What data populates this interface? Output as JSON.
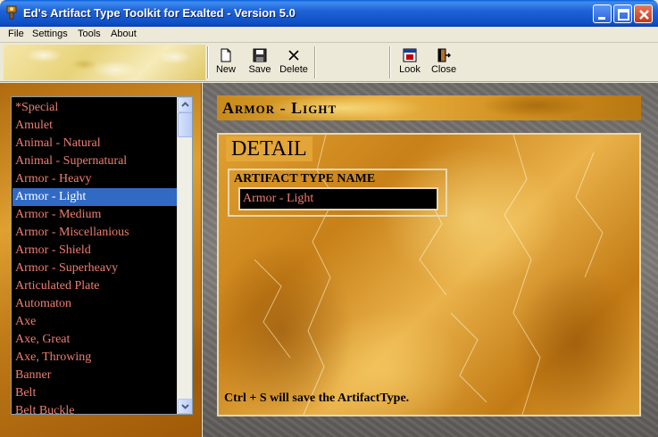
{
  "window": {
    "title": "Ed's Artifact Type Toolkit for Exalted - Version 5.0",
    "controls": [
      "minimize-icon",
      "maximize-icon",
      "close-icon"
    ]
  },
  "menu": {
    "items": [
      "File",
      "Settings",
      "Tools",
      "About"
    ]
  },
  "toolbar": {
    "new_label": "New",
    "save_label": "Save",
    "delete_label": "Delete",
    "look_label": "Look",
    "close_label": "Close"
  },
  "artifact_list": {
    "items": [
      "*Special",
      "Amulet",
      "Animal - Natural",
      "Animal - Supernatural",
      "Armor - Heavy",
      "Armor - Light",
      "Armor - Medium",
      "Armor - Miscellanious",
      "Armor - Shield",
      "Armor - Superheavy",
      "Articulated Plate",
      "Automaton",
      "Axe",
      "Axe, Great",
      "Axe, Throwing",
      "Banner",
      "Belt",
      "Belt Buckle"
    ],
    "selected": "Armor - Light"
  },
  "header": {
    "title": "Armor - Light"
  },
  "detail": {
    "section_label": "DETAIL",
    "name_label": "ARTIFACT TYPE NAME",
    "name_value": "Armor - Light",
    "hint": "Ctrl + S will save the ArtifactType."
  },
  "colors": {
    "title_bar": "#0e4fc4",
    "list_background": "#000000",
    "list_text": "#ee7e6e",
    "selection": "#316ac5",
    "gold": "#e0a030"
  }
}
